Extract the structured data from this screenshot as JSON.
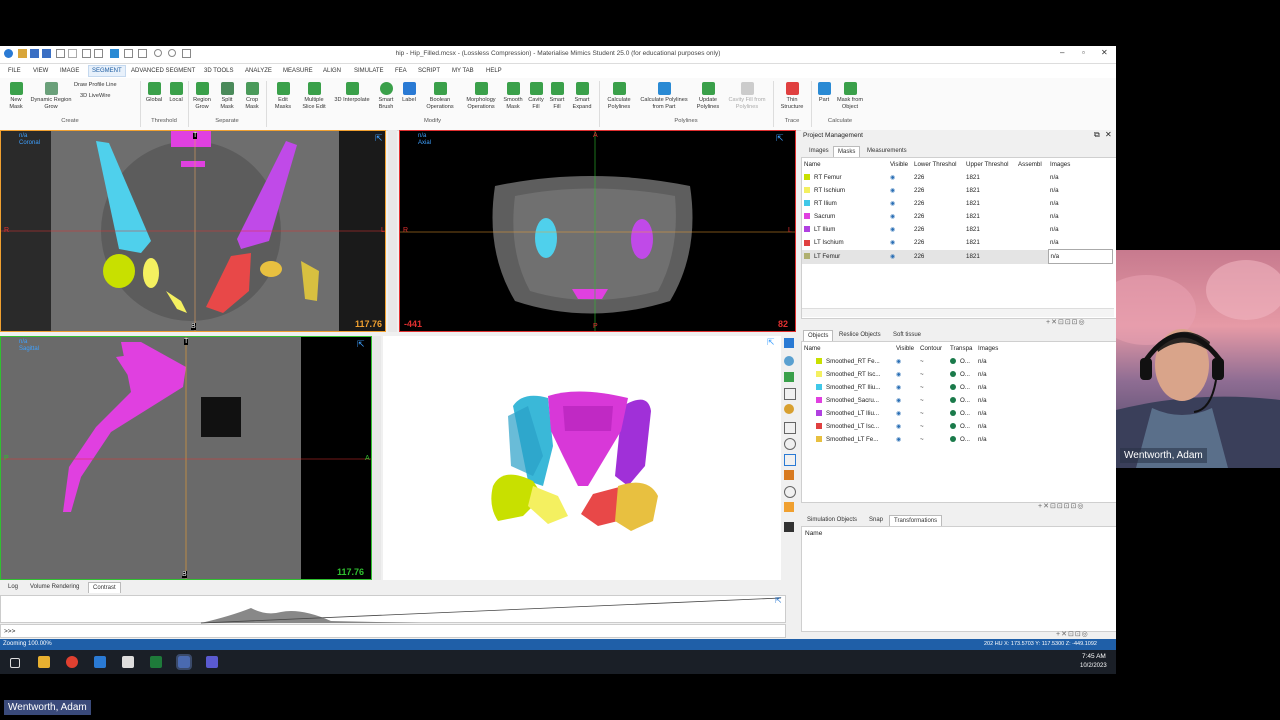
{
  "window": {
    "title": "hip - Hip_Filled.mcsx - (Lossless Compression) - Materialise Mimics Student 25.0  (for educational purposes only)"
  },
  "menu": [
    "FILE",
    "VIEW",
    "IMAGE",
    "SEGMENT",
    "ADVANCED SEGMENT",
    "3D TOOLS",
    "ANALYZE",
    "MEASURE",
    "ALIGN",
    "SIMULATE",
    "FEA",
    "SCRIPT",
    "MY TAB",
    "HELP"
  ],
  "menu_active": "SEGMENT",
  "ribbon": {
    "create": {
      "new_mask": "New Mask",
      "dynamic_region_grow": "Dynamic Region Grow",
      "draw_profile_line": "Draw Profile Line",
      "livewire": "3D LiveWire",
      "group": "Create"
    },
    "threshold": {
      "global": "Global",
      "local": "Local",
      "group": "Threshold"
    },
    "separate": {
      "region_grow": "Region Grow",
      "split_mask": "Split Mask",
      "crop_mask": "Crop Mask",
      "group": "Separate"
    },
    "modify": {
      "edit_masks": "Edit Masks",
      "multiple_slice_edit": "Multiple Slice Edit",
      "interpolate": "3D Interpolate",
      "smart_brush": "Smart Brush",
      "label": "Label",
      "boolean": "Boolean Operations",
      "morphology": "Morphology Operations",
      "smooth_mask": "Smooth Mask",
      "cavity_fill": "Cavity Fill",
      "smart_fill": "Smart Fill",
      "smart_expand": "Smart Expand",
      "group": "Modify"
    },
    "polylines": {
      "calculate": "Calculate Polylines",
      "from_part": "Calculate Polylines from Part",
      "update": "Update Polylines",
      "cavity_fill_from": "Cavity Fill from Polylines",
      "group": "Polylines"
    },
    "trace": {
      "thin_structure": "Thin Structure",
      "group": "Trace"
    },
    "calculate": {
      "part": "Part",
      "mask_from_object": "Mask from Object",
      "group": "Calculate"
    }
  },
  "viewports": {
    "coronal": {
      "name": "n/a",
      "view": "Coronal",
      "mm": "117.76",
      "left": "R",
      "right": "L",
      "top": "T",
      "bottom": "B"
    },
    "axial": {
      "name": "n/a",
      "view": "Axial",
      "mm": "82",
      "left_num": "-441",
      "left": "R",
      "right": "L",
      "top": "A",
      "bottom": "P"
    },
    "sagittal": {
      "name": "n/a",
      "view": "Sagittal",
      "mm": "117.76",
      "left": "P",
      "right": "A",
      "top": "T",
      "bottom": "B"
    }
  },
  "project": {
    "title": "Project Management",
    "tabs": [
      "Images",
      "Masks",
      "Measurements"
    ],
    "active_tab": "Masks",
    "columns": [
      "Name",
      "Visible",
      "Lower Threshol",
      "Upper Threshol",
      "Assembl",
      "Images"
    ],
    "masks": [
      {
        "name": "RT Femur",
        "color": "#c8e000",
        "lower": "226",
        "upper": "1821",
        "images": "n/a"
      },
      {
        "name": "RT Ischium",
        "color": "#f4f060",
        "lower": "226",
        "upper": "1821",
        "images": "n/a"
      },
      {
        "name": "RT Ilium",
        "color": "#40c8e8",
        "lower": "226",
        "upper": "1821",
        "images": "n/a"
      },
      {
        "name": "Sacrum",
        "color": "#e040e0",
        "lower": "226",
        "upper": "1821",
        "images": "n/a"
      },
      {
        "name": "LT Ilium",
        "color": "#b040e0",
        "lower": "226",
        "upper": "1821",
        "images": "n/a"
      },
      {
        "name": "LT Ischium",
        "color": "#e04040",
        "lower": "226",
        "upper": "1821",
        "images": "n/a"
      },
      {
        "name": "LT Femur",
        "color": "#b0b070",
        "lower": "226",
        "upper": "1821",
        "images": "n/a"
      }
    ]
  },
  "objects": {
    "tabs": [
      "Objects",
      "Reslice Objects",
      "Soft tissue"
    ],
    "active_tab": "Objects",
    "columns": [
      "Name",
      "Visible",
      "Contour",
      "Transpa",
      "Images"
    ],
    "items": [
      {
        "name": "Smoothed_RT Fe...",
        "color": "#c8e000",
        "transp": "O...",
        "images": "n/a"
      },
      {
        "name": "Smoothed_RT Isc...",
        "color": "#f4f060",
        "transp": "O...",
        "images": "n/a"
      },
      {
        "name": "Smoothed_RT Iliu...",
        "color": "#40c8e8",
        "transp": "O...",
        "images": "n/a"
      },
      {
        "name": "Smoothed_Sacru...",
        "color": "#e040e0",
        "transp": "O...",
        "images": "n/a"
      },
      {
        "name": "Smoothed_LT Iliu...",
        "color": "#b040e0",
        "transp": "O...",
        "images": "n/a"
      },
      {
        "name": "Smoothed_LT Isc...",
        "color": "#e04040",
        "transp": "O...",
        "images": "n/a"
      },
      {
        "name": "Smoothed_LT Fe...",
        "color": "#e8c040",
        "transp": "O...",
        "images": "n/a"
      }
    ]
  },
  "simulation": {
    "tabs": [
      "Simulation Objects",
      "Snap",
      "Transformations"
    ],
    "active_tab": "Transformations",
    "column": "Name"
  },
  "bottom_tabs": [
    "Log",
    "Volume Rendering",
    "Contrast"
  ],
  "bottom_active_tab": "Contrast",
  "console_prompt": ">>>",
  "status": {
    "left": "Zooming 100.00%",
    "right": "202 HU  X: 173.5703 Y: 117.5300 Z: -449.1092"
  },
  "taskbar": {
    "time": "7:45 AM",
    "date": "10/2/2023"
  },
  "webcam_name": "Wentworth, Adam",
  "viewer_name": "Wentworth, Adam"
}
